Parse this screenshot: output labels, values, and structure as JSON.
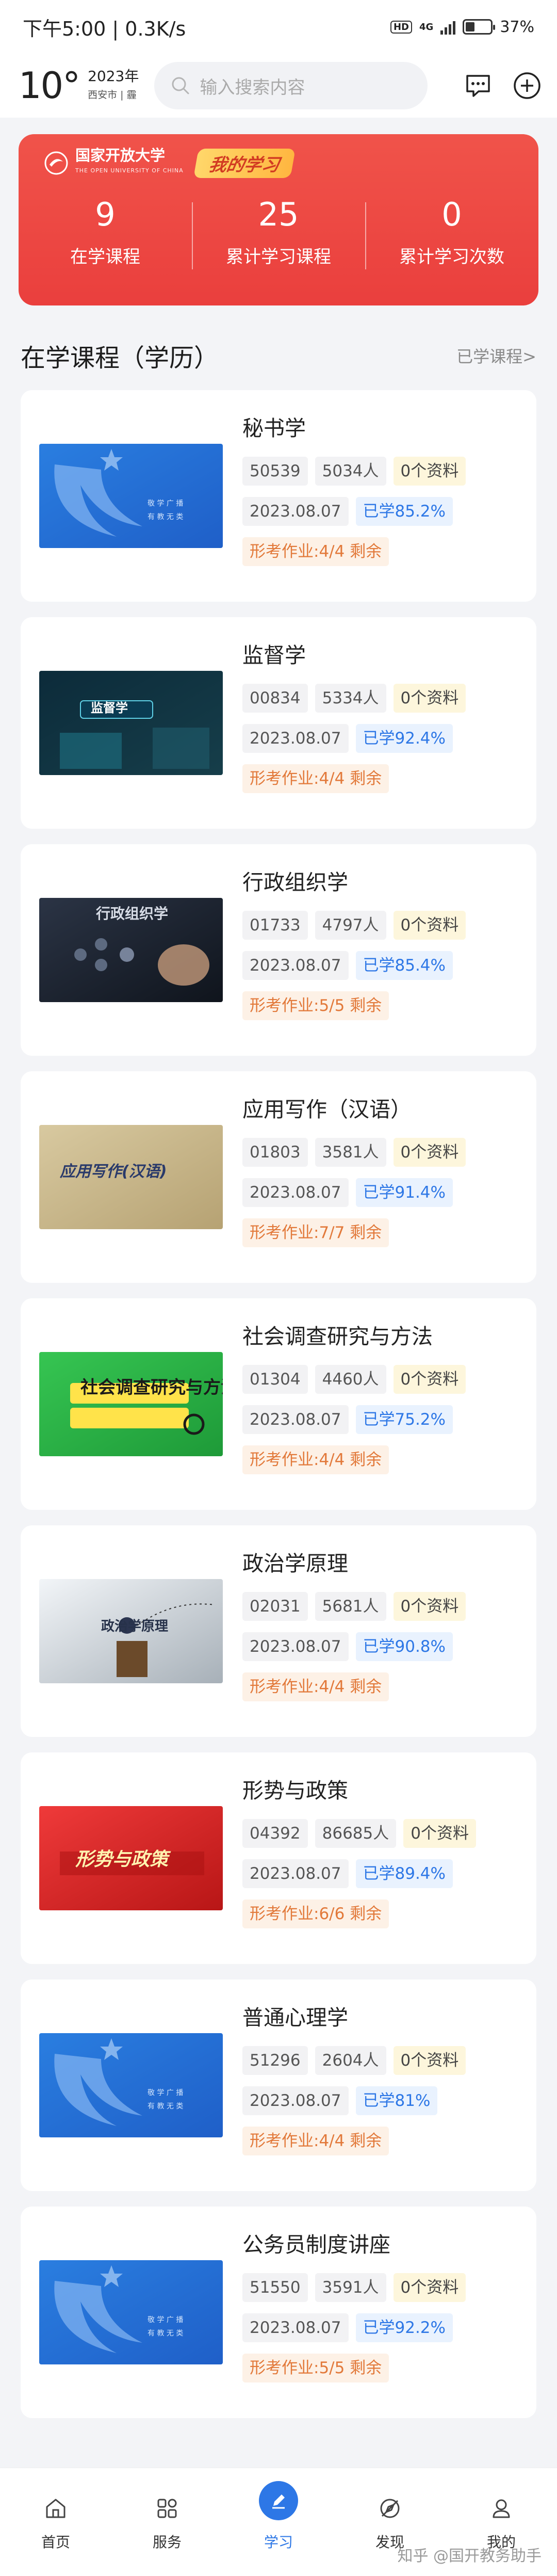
{
  "status": {
    "time_speed": "下午5:00 | 0.3K/s",
    "hd": "HD",
    "net": "4G",
    "battery": "37%",
    "battery_level": 0.37
  },
  "header": {
    "temp": "10°",
    "year": "2023年",
    "city": "西安市",
    "weather": "霾",
    "search_placeholder": "输入搜索内容"
  },
  "banner": {
    "logo_name": "国家开放大学",
    "logo_sub": "THE OPEN UNIVERSITY OF CHINA",
    "tag": "我的学习",
    "stats": [
      {
        "num": "9",
        "label": "在学课程"
      },
      {
        "num": "25",
        "label": "累计学习课程"
      },
      {
        "num": "0",
        "label": "累计学习次数"
      }
    ]
  },
  "section": {
    "title": "在学课程（学历）",
    "link": "已学课程>"
  },
  "courses": [
    {
      "title": "秘书学",
      "code": "50539",
      "people": "5034人",
      "materials": "0个资料",
      "date": "2023.08.07",
      "progress": "已学85.2%",
      "homework": "形考作业:4/4 剩余",
      "thumb": "default"
    },
    {
      "title": "监督学",
      "code": "00834",
      "people": "5334人",
      "materials": "0个资料",
      "date": "2023.08.07",
      "progress": "已学92.4%",
      "homework": "形考作业:4/4 剩余",
      "thumb": "supervision",
      "thumb_text": "监督学"
    },
    {
      "title": "行政组织学",
      "code": "01733",
      "people": "4797人",
      "materials": "0个资料",
      "date": "2023.08.07",
      "progress": "已学85.4%",
      "homework": "形考作业:5/5 剩余",
      "thumb": "org",
      "thumb_text": "行政组织学"
    },
    {
      "title": "应用写作（汉语）",
      "code": "01803",
      "people": "3581人",
      "materials": "0个资料",
      "date": "2023.08.07",
      "progress": "已学91.4%",
      "homework": "形考作业:7/7 剩余",
      "thumb": "writing",
      "thumb_text": "应用写作(汉语)"
    },
    {
      "title": "社会调查研究与方法",
      "code": "01304",
      "people": "4460人",
      "materials": "0个资料",
      "date": "2023.08.07",
      "progress": "已学75.2%",
      "homework": "形考作业:4/4 剩余",
      "thumb": "survey",
      "thumb_text": "社会调查研究与方法"
    },
    {
      "title": "政治学原理",
      "code": "02031",
      "people": "5681人",
      "materials": "0个资料",
      "date": "2023.08.07",
      "progress": "已学90.8%",
      "homework": "形考作业:4/4 剩余",
      "thumb": "politics",
      "thumb_text": "政治学原理"
    },
    {
      "title": "形势与政策",
      "code": "04392",
      "people": "86685人",
      "materials": "0个资料",
      "date": "2023.08.07",
      "progress": "已学89.4%",
      "homework": "形考作业:6/6 剩余",
      "thumb": "policy",
      "thumb_text": "形势与政策"
    },
    {
      "title": "普通心理学",
      "code": "51296",
      "people": "2604人",
      "materials": "0个资料",
      "date": "2023.08.07",
      "progress": "已学81%",
      "homework": "形考作业:4/4 剩余",
      "thumb": "default"
    },
    {
      "title": "公务员制度讲座",
      "code": "51550",
      "people": "3591人",
      "materials": "0个资料",
      "date": "2023.08.07",
      "progress": "已学92.2%",
      "homework": "形考作业:5/5 剩余",
      "thumb": "default"
    }
  ],
  "default_thumb_text": [
    "敬 学 广 播",
    "有 教 无 类"
  ],
  "tabs": [
    {
      "label": "首页",
      "icon": "home-icon"
    },
    {
      "label": "服务",
      "icon": "grid-icon"
    },
    {
      "label": "学习",
      "icon": "pen-icon",
      "active": true
    },
    {
      "label": "发现",
      "icon": "compass-icon"
    },
    {
      "label": "我的",
      "icon": "user-icon"
    }
  ],
  "watermark": "知乎 @国开教务助手",
  "colors": {
    "accent": "#2d77e6",
    "banner": "#ea3f3d"
  }
}
